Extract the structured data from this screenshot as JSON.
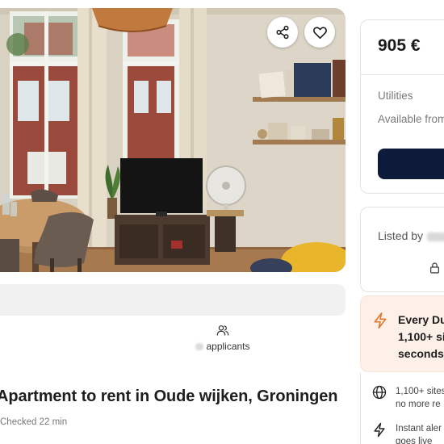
{
  "listing": {
    "title": "Apartment to rent in Oude wijken, Groningen",
    "checked": "Checked 22 min"
  },
  "photo": {
    "share_icon": "share-icon",
    "favorite_icon": "heart-icon"
  },
  "applicants": {
    "icon": "users-icon",
    "label": "applicants"
  },
  "sidebar": {
    "price": "905 €",
    "utilities_label": "Utilities",
    "available_label": "Available from",
    "listed_by_label": "Listed by",
    "lock_icon": "lock-icon"
  },
  "promo": {
    "icon": "lightning-icon",
    "line1": "Every Du",
    "line2": "1,100+ si",
    "line3": "seconds."
  },
  "features": [
    {
      "icon": "globe-icon",
      "line1": "1,100+ sites",
      "line2": "no more re"
    },
    {
      "icon": "lightning-icon",
      "line1": "Instant aler",
      "line2": "goes live"
    }
  ],
  "colors": {
    "primary": "#0d1a3a",
    "promo_bg": "#fdf0e9",
    "accent_orange": "#e0782e"
  }
}
